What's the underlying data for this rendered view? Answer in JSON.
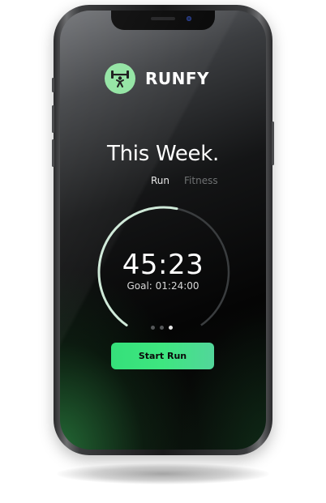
{
  "app": {
    "brand_name": "RUNFY",
    "logo_icon": "dumbbell-person-icon",
    "accent_color": "#3ee680",
    "logo_color": "#8fe3a0"
  },
  "summary": {
    "title": "This Week.",
    "tabs": [
      {
        "label": "Run",
        "active": true
      },
      {
        "label": "Fitness",
        "active": false
      }
    ]
  },
  "timer": {
    "value": "45:23",
    "goal_label": "Goal: 01:24:00",
    "progress_fraction": 0.54
  },
  "pager": {
    "count": 3,
    "active_index": 2
  },
  "actions": {
    "start_label": "Start Run"
  }
}
